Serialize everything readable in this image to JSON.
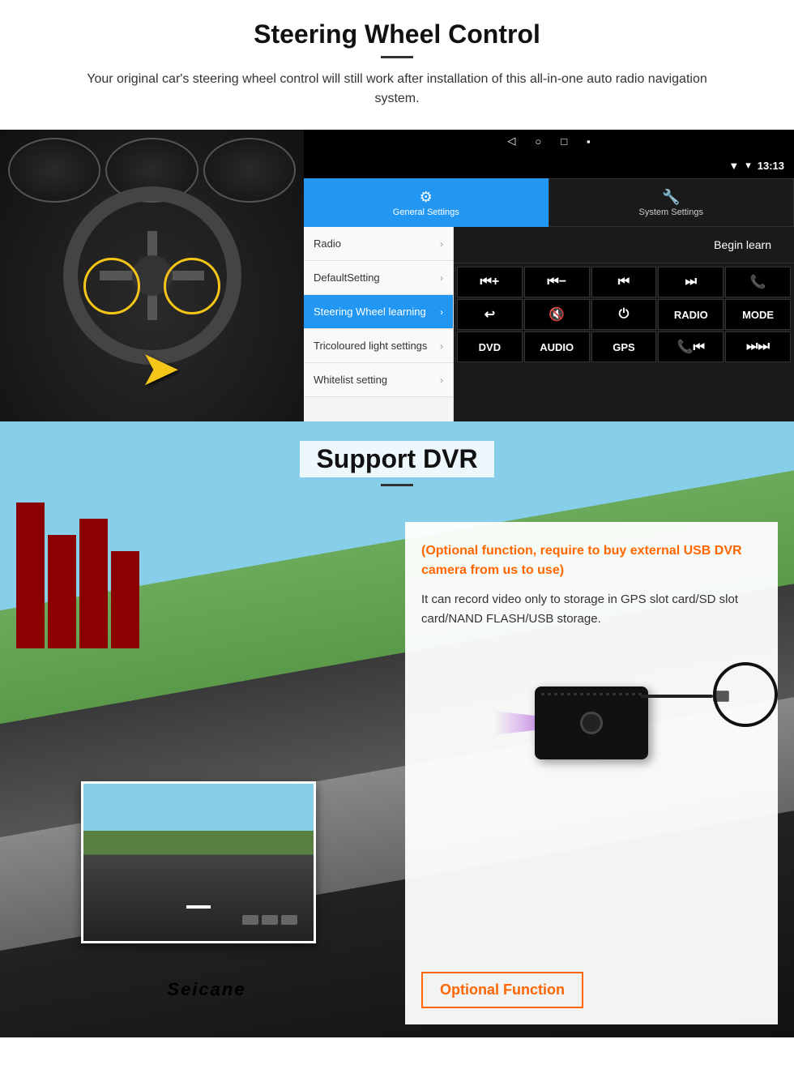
{
  "steering_section": {
    "title": "Steering Wheel Control",
    "description": "Your original car's steering wheel control will still work after installation of this all-in-one auto radio navigation system.",
    "android_ui": {
      "status_time": "13:13",
      "status_signal": "▼",
      "tabs": [
        {
          "id": "general",
          "label": "General Settings",
          "icon": "⚙"
        },
        {
          "id": "system",
          "label": "System Settings",
          "icon": "🔧"
        }
      ],
      "menu_items": [
        {
          "label": "Radio",
          "active": false
        },
        {
          "label": "DefaultSetting",
          "active": false
        },
        {
          "label": "Steering Wheel learning",
          "active": true
        },
        {
          "label": "Tricoloured light settings",
          "active": false
        },
        {
          "label": "Whitelist setting",
          "active": false
        }
      ],
      "begin_learn_label": "Begin learn",
      "controls": [
        [
          "⏮+",
          "⏮−",
          "⏮⏮",
          "⏭⏭",
          "📞"
        ],
        [
          "↩",
          "🔇",
          "⏻",
          "RADIO",
          "MODE"
        ],
        [
          "DVD",
          "AUDIO",
          "GPS",
          "📞⏮",
          "⏭⏭"
        ]
      ]
    }
  },
  "dvr_section": {
    "title": "Support DVR",
    "optional_text": "(Optional function, require to buy external USB DVR camera from us to use)",
    "description": "It can record video only to storage in GPS slot card/SD slot card/NAND FLASH/USB storage.",
    "optional_badge_label": "Optional Function",
    "brand": "Seicane"
  }
}
